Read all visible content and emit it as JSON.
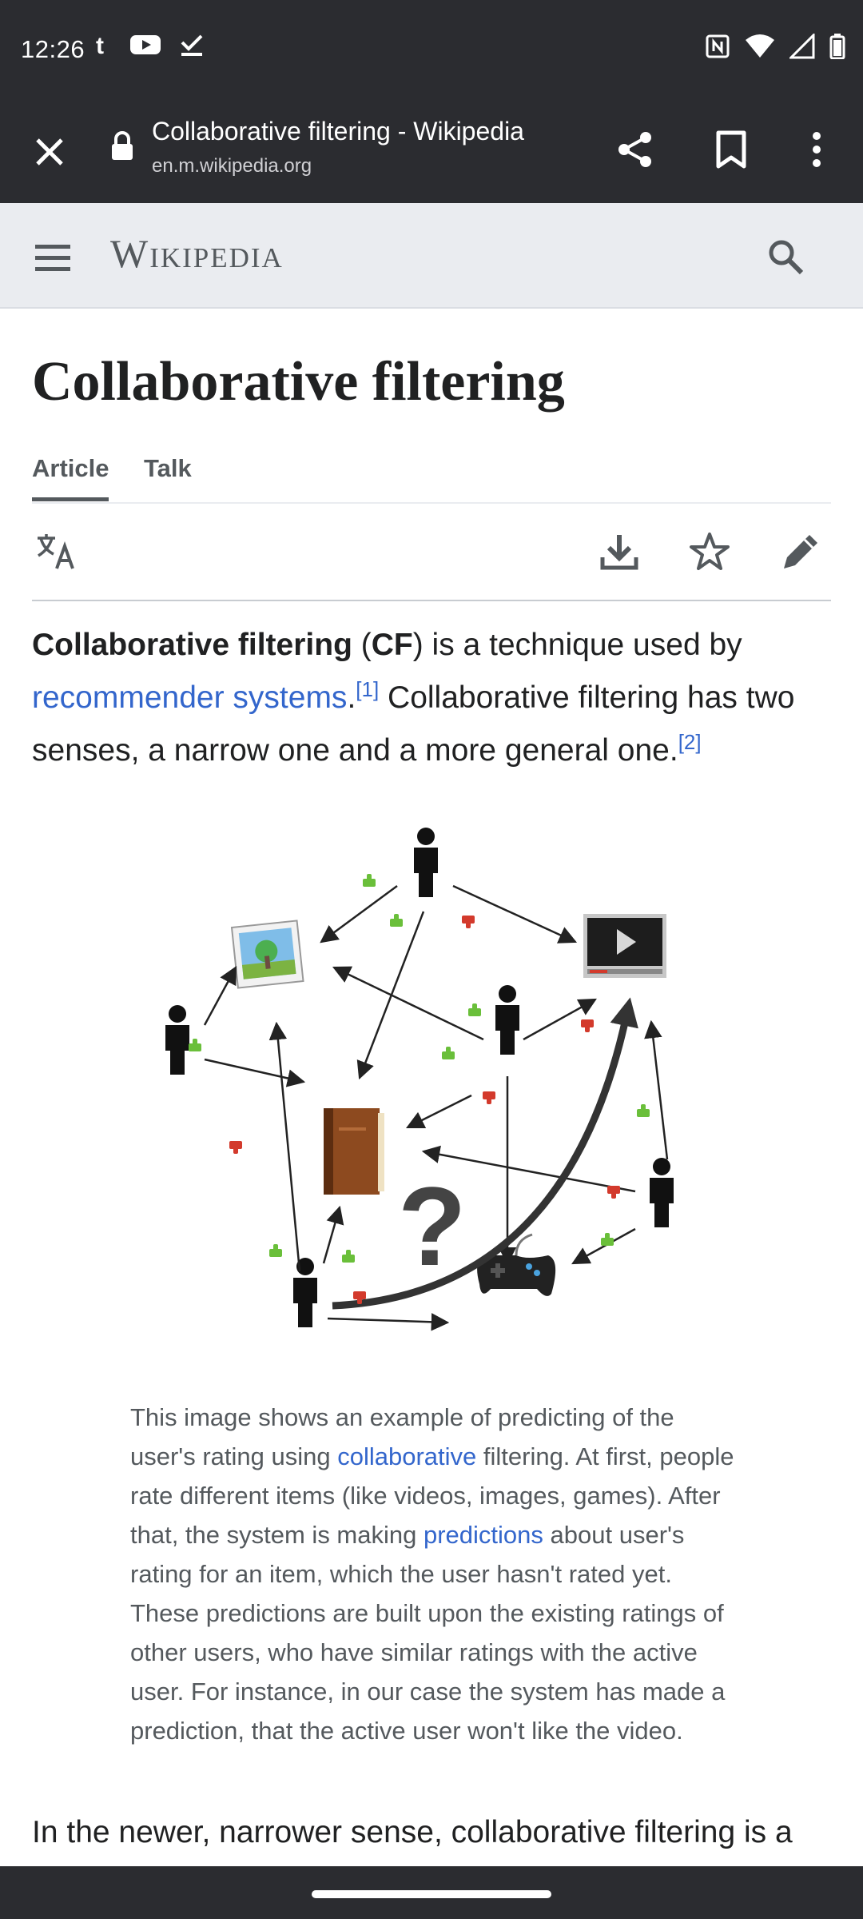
{
  "status_bar": {
    "time": "12:26",
    "left_icons": [
      "tumblr-icon",
      "youtube-icon",
      "check-icon"
    ],
    "right_icons": [
      "nfc-icon",
      "wifi-icon",
      "signal-icon",
      "battery-icon"
    ]
  },
  "custom_tab": {
    "title": "Collaborative filtering - Wikipedia",
    "url": "en.m.wikipedia.org",
    "icons": [
      "close-icon",
      "lock-icon",
      "share-icon",
      "bookmark-icon",
      "more-vert-icon"
    ]
  },
  "wiki_header": {
    "wordmark": "Wikipedia",
    "icons": [
      "menu-icon",
      "search-icon"
    ]
  },
  "article": {
    "title": "Collaborative filtering",
    "tabs": [
      {
        "label": "Article",
        "selected": true
      },
      {
        "label": "Talk",
        "selected": false
      }
    ],
    "page_actions": [
      "language-icon",
      "download-icon",
      "star-icon",
      "edit-icon"
    ],
    "lead": {
      "bold_term": "Collaborative filtering",
      "paren_open": " (",
      "bold_abbr": "CF",
      "text_1": ") is a technique used by ",
      "link_1": "recommender systems",
      "text_2": ".",
      "ref_1": "[1]",
      "text_3": " Collaborative filtering has two senses, a narrow one and a more general one.",
      "ref_2": "[2]"
    },
    "caption": {
      "text_1": "This image shows an example of predicting of the user's rating using ",
      "link_1": "collaborative",
      "text_2": " filtering. At first, people rate different items (like videos, images, games). After that, the system is making ",
      "link_2": "predictions",
      "text_3": " about user's rating for an item, which the user hasn't rated yet. These predictions are built upon the existing ratings of other users, who have similar ratings with the active user. For instance, in our case the system has made a prediction, that the active user won't like the video."
    },
    "para_2": "In the newer, narrower sense, collaborative filtering is a"
  },
  "colors": {
    "chrome_dark": "#2b2c30",
    "link": "#3366cc",
    "header_bg": "#eaecf0",
    "thumb_up": "#6abf3a",
    "thumb_down": "#d33a2c"
  }
}
